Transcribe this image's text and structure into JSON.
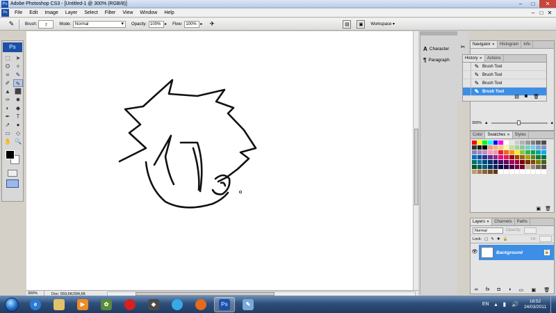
{
  "window": {
    "title": "Adobe Photoshop CS3 - [Untitled-1 @ 300% (RGB/8)]",
    "min": "–",
    "max": "□",
    "close": "✕",
    "app_icon_text": "Ps"
  },
  "menu": {
    "items": [
      "File",
      "Edit",
      "Image",
      "Layer",
      "Select",
      "Filter",
      "View",
      "Window",
      "Help"
    ]
  },
  "options": {
    "brush_label": "Brush:",
    "brush_size": "2",
    "mode_label": "Mode:",
    "mode_value": "Normal",
    "opacity_label": "Opacity:",
    "opacity_value": "100%",
    "flow_label": "Flow:",
    "flow_value": "100%",
    "workspace_label": "Workspace ▾"
  },
  "tools": {
    "logo": "Ps",
    "icons": [
      "⬚",
      "➤",
      "ʘ",
      "✧",
      "⌗",
      "✎",
      "✐",
      "✎",
      "▲",
      "⬛",
      "✑",
      "✹",
      "◐",
      "◆",
      "✒",
      "T",
      "➚",
      "●",
      "▭",
      "◇",
      "✋",
      "🔍"
    ]
  },
  "status": {
    "zoom": "300%",
    "doc": "Doc: 559,6K/394,6K"
  },
  "dock": {
    "character": "Character",
    "paragraph": "Paragraph",
    "character_icon": "A",
    "paragraph_icon": "¶"
  },
  "navigator": {
    "tabs": [
      "Navigator",
      "Histogram",
      "Info"
    ],
    "zoom": "300%"
  },
  "history": {
    "tabs": [
      "History",
      "Actions"
    ],
    "items": [
      "Brush Tool",
      "Brush Tool",
      "Brush Tool",
      "Brush Tool"
    ],
    "selected_index": 3
  },
  "swatches": {
    "tabs": [
      "Color",
      "Swatches",
      "Styles"
    ]
  },
  "layers": {
    "tabs": [
      "Layers",
      "Channels",
      "Paths"
    ],
    "blend_mode": "Normal",
    "opacity_label": "Opacity:",
    "lock_label": "Lock:",
    "fill_label": "Fill:",
    "layer_name": "Background"
  },
  "taskbar": {
    "language": "EN",
    "time": "18:52",
    "date": "24/03/2011",
    "photoshop_label": "Ps"
  },
  "colors": {
    "accent": "#3d8ee6",
    "foreground": "#000000",
    "background": "#ffffff"
  }
}
